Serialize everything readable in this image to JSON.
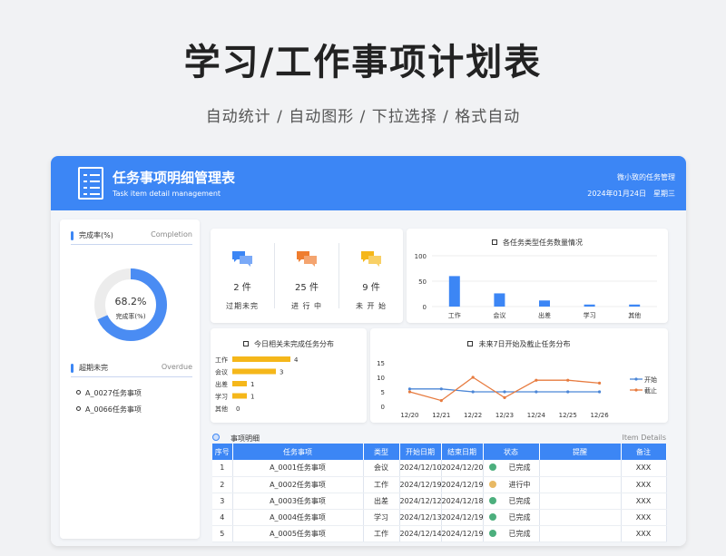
{
  "page": {
    "title": "学习/工作事项计划表",
    "subtitle": "自动统计  /  自动图形  /  下拉选择  /  格式自动"
  },
  "header": {
    "title": "任务事项明细管理表",
    "subtitle": "Task item detail management",
    "org": "微小致的任务管理",
    "date": "2024年01月24日",
    "weekday": "星期三"
  },
  "completion": {
    "title": "完成率(%)",
    "title_en": "Completion",
    "percent": 68.2,
    "percent_text": "68.2%",
    "label": "完成率(%)"
  },
  "overdue": {
    "title": "超期未完",
    "title_en": "Overdue",
    "items": [
      "A_0027任务事项",
      "A_0066任务事项"
    ]
  },
  "stats": [
    {
      "count": "2 件",
      "label": "过期未完",
      "icon": "chat-bubbles-icon",
      "color": "#3c86f5"
    },
    {
      "count": "25 件",
      "label": "进 行 中",
      "icon": "chat-bubbles-icon",
      "color": "#ef7d2f"
    },
    {
      "count": "9 件",
      "label": "未 开 始",
      "icon": "chat-bubbles-icon",
      "color": "#f5b71a"
    }
  ],
  "chart_data": [
    {
      "type": "bar",
      "title": "各任务类型任务数量情况",
      "categories": [
        "工作",
        "会议",
        "出差",
        "学习",
        "其他"
      ],
      "values": [
        60,
        26,
        12,
        4,
        4
      ],
      "ylim": [
        0,
        100
      ],
      "yticks": [
        0,
        50,
        100
      ],
      "color": "#3c86f5"
    },
    {
      "type": "bar",
      "orientation": "horizontal",
      "title": "今日相关未完成任务分布",
      "categories": [
        "工作",
        "会议",
        "出差",
        "学习",
        "其他"
      ],
      "values": [
        4,
        3,
        1,
        1,
        0
      ],
      "color": "#f5b71a"
    },
    {
      "type": "line",
      "title": "未来7日开始及截止任务分布",
      "x": [
        "12/20",
        "12/21",
        "12/22",
        "12/23",
        "12/24",
        "12/25",
        "12/26"
      ],
      "ylim": [
        0,
        15
      ],
      "yticks": [
        0,
        5,
        10,
        15
      ],
      "legend": "right",
      "series": [
        {
          "name": "开始",
          "values": [
            6,
            6,
            5,
            5,
            5,
            5,
            5
          ],
          "color": "#4b86d6"
        },
        {
          "name": "截止",
          "values": [
            5,
            2,
            10,
            3,
            9,
            9,
            8
          ],
          "color": "#e77b3f"
        }
      ]
    }
  ],
  "table": {
    "title": "事项明细",
    "title_en": "Item Details",
    "columns": [
      "序号",
      "任务事项",
      "类型",
      "开始日期",
      "结束日期",
      "状态",
      "提醒",
      "备注"
    ],
    "rows": [
      {
        "no": "1",
        "task": "A_0001任务事项",
        "type": "会议",
        "start": "2024/12/10",
        "end": "2024/12/20",
        "status": "已完成",
        "status_color": "#4caf7d",
        "remind": "",
        "note": "XXX"
      },
      {
        "no": "2",
        "task": "A_0002任务事项",
        "type": "工作",
        "start": "2024/12/19",
        "end": "2024/12/19",
        "status": "进行中",
        "status_color": "#e8b964",
        "remind": "",
        "note": "XXX"
      },
      {
        "no": "3",
        "task": "A_0003任务事项",
        "type": "出差",
        "start": "2024/12/12",
        "end": "2024/12/18",
        "status": "已完成",
        "status_color": "#4caf7d",
        "remind": "",
        "note": "XXX"
      },
      {
        "no": "4",
        "task": "A_0004任务事项",
        "type": "学习",
        "start": "2024/12/13",
        "end": "2024/12/19",
        "status": "已完成",
        "status_color": "#4caf7d",
        "remind": "",
        "note": "XXX"
      },
      {
        "no": "5",
        "task": "A_0005任务事项",
        "type": "工作",
        "start": "2024/12/14",
        "end": "2024/12/19",
        "status": "已完成",
        "status_color": "#4caf7d",
        "remind": "",
        "note": "XXX"
      }
    ]
  }
}
